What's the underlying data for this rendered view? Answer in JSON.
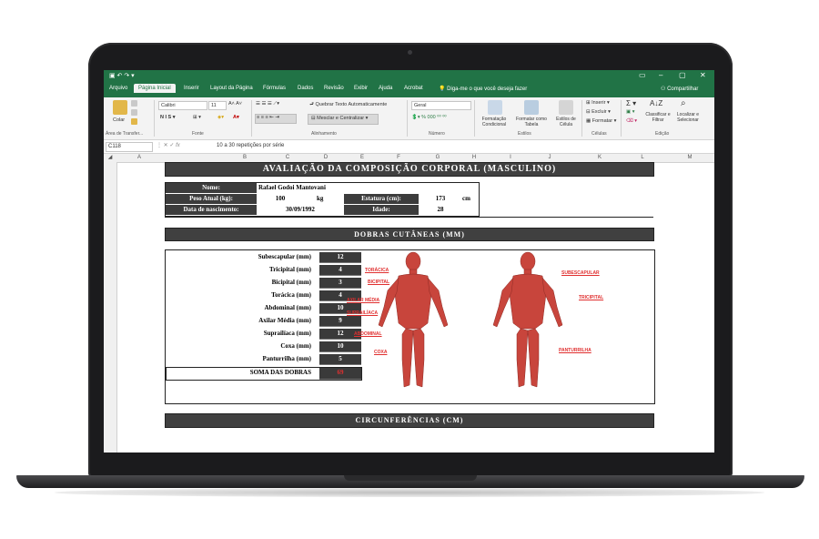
{
  "excel": {
    "ribbon_tabs": [
      "Arquivo",
      "Página Inicial",
      "Inserir",
      "Layout da Página",
      "Fórmulas",
      "Dados",
      "Revisão",
      "Exibir",
      "Ajuda",
      "Acrobat"
    ],
    "active_tab": "Página Inicial",
    "tell_me": "Diga-me o que você deseja fazer",
    "share": "Compartilhar",
    "groups": {
      "clipboard": "Área de Transfer...",
      "font": "Fonte",
      "alignment": "Alinhamento",
      "number": "Número",
      "styles": "Estilos",
      "cells": "Células",
      "editing": "Edição"
    },
    "paste_label": "Colar",
    "font_name": "Calibri",
    "font_size": "11",
    "wrap_text": "Quebrar Texto Automaticamente",
    "merge_center": "Mesclar e Centralizar",
    "number_format": "Geral",
    "conditional_formatting": "Formatação Condicional",
    "format_as_table": "Formatar como Tabela",
    "cell_styles": "Estilos de Célula",
    "insert": "Inserir",
    "delete": "Excluir",
    "format": "Formatar",
    "sort_filter": "Classificar e Filtrar",
    "find_select": "Localizar e Selecionar",
    "name_box": "C118",
    "formula": "10 a 30 repetições por série",
    "columns": [
      "A",
      "B",
      "C",
      "D",
      "E",
      "F",
      "G",
      "H",
      "I",
      "J",
      "K",
      "L",
      "M"
    ]
  },
  "sheet": {
    "title": "AVALIAÇÃO DA COMPOSIÇÃO CORPORAL (MASCULINO)",
    "info": {
      "name_label": "Nome:",
      "name_value": "Rafael Godoi Mantovani",
      "weight_label": "Peso Atual (kg):",
      "weight_value": "100",
      "weight_unit": "kg",
      "height_label": "Estatura (cm):",
      "height_value": "173",
      "height_unit": "cm",
      "birth_label": "Data de nascimento:",
      "birth_value": "30/09/1992",
      "age_label": "Idade:",
      "age_value": "28"
    },
    "skinfolds_title": "DOBRAS CUTÂNEAS (MM)",
    "skinfolds": [
      {
        "label": "Subescapular (mm)",
        "value": "12"
      },
      {
        "label": "Tricipital (mm)",
        "value": "4"
      },
      {
        "label": "Bicipital (mm)",
        "value": "3"
      },
      {
        "label": "Torácica (mm)",
        "value": "4"
      },
      {
        "label": "Abdominal (mm)",
        "value": "10"
      },
      {
        "label": "Axilar Média (mm)",
        "value": "9"
      },
      {
        "label": "Suprailíaca (mm)",
        "value": "12"
      },
      {
        "label": "Coxa (mm)",
        "value": "10"
      },
      {
        "label": "Panturrilha (mm)",
        "value": "5"
      }
    ],
    "sum_label": "SOMA DAS DOBRAS",
    "sum_value": "69",
    "annotations_front": [
      "TORÁCICA",
      "BICIPITAL",
      "AXILAR MÉDIA",
      "SUPRAILÍACA",
      "ABDOMINAL",
      "COXA"
    ],
    "annotations_back": [
      "SUBESCAPULAR",
      "TRICIPITAL",
      "PANTURRILHA"
    ],
    "circumferences_title": "CIRCUNFERÊNCIAS (CM)"
  },
  "colors": {
    "excel_green": "#217346",
    "dark_header": "#404040",
    "annotation_red": "#e03030"
  }
}
